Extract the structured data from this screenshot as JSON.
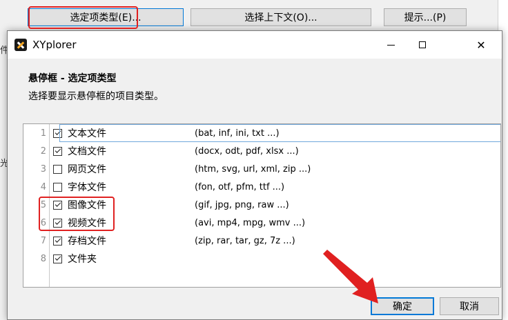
{
  "background": {
    "buttons": [
      {
        "label": "选定项类型(E)..."
      },
      {
        "label": "选择上下文(O)..."
      },
      {
        "label": "提示...(P)"
      }
    ],
    "left_marks": [
      "件",
      "光"
    ]
  },
  "dialog": {
    "title": "XYplorer",
    "heading": "悬停框 - 选定项类型",
    "subheading": "选择要显示悬停框的项目类型。",
    "close_glyph": "✕",
    "items": [
      {
        "num": "1",
        "checked": true,
        "label": "文本文件",
        "exts": "(bat, inf, ini, txt ...)"
      },
      {
        "num": "2",
        "checked": true,
        "label": "文档文件",
        "exts": "(docx, odt, pdf, xlsx ...)"
      },
      {
        "num": "3",
        "checked": false,
        "label": "网页文件",
        "exts": "(htm, svg, url, xml, zip ...)"
      },
      {
        "num": "4",
        "checked": false,
        "label": "字体文件",
        "exts": "(fon, otf, pfm, ttf ...)"
      },
      {
        "num": "5",
        "checked": true,
        "label": "图像文件",
        "exts": "(gif, jpg, png, raw ...)"
      },
      {
        "num": "6",
        "checked": true,
        "label": "视频文件",
        "exts": "(avi, mp4, mpg, wmv ...)"
      },
      {
        "num": "7",
        "checked": true,
        "label": "存档文件",
        "exts": "(zip, rar, tar, gz, 7z ...)"
      },
      {
        "num": "8",
        "checked": true,
        "label": "文件夹",
        "exts": ""
      }
    ],
    "ok_label": "确定",
    "cancel_label": "取消"
  },
  "colors": {
    "highlight_red": "#e02020",
    "focus_blue": "#0078d7"
  }
}
